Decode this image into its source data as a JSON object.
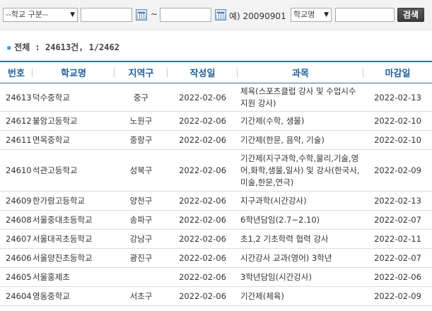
{
  "search": {
    "category_select": "--학교 구분--",
    "example_label": "예) 20090901",
    "field_select": "학교명",
    "tilde": "~",
    "button": "검색",
    "date_from": "",
    "date_to": "",
    "keyword": ""
  },
  "summary": {
    "text": "전체 : 24613건, 1/2462"
  },
  "table": {
    "headers": [
      "번호",
      "학교명",
      "지역구",
      "작성일",
      "과목",
      "마감일"
    ],
    "rows": [
      {
        "no": "24613",
        "school": "덕수중학교",
        "district": "중구",
        "written": "2022-02-06",
        "subject": "체육(스포츠클럽 강사 및 수업시수 지원 강사)",
        "deadline": "2022-02-13"
      },
      {
        "no": "24612",
        "school": "불암고등학교",
        "district": "노원구",
        "written": "2022-02-06",
        "subject": "기간제(수학, 생물)",
        "deadline": "2022-02-10"
      },
      {
        "no": "24611",
        "school": "면목중학교",
        "district": "중랑구",
        "written": "2022-02-06",
        "subject": "기간제(한문, 음악, 기술)",
        "deadline": "2022-02-10"
      },
      {
        "no": "24610",
        "school": "석관고등학교",
        "district": "성북구",
        "written": "2022-02-06",
        "subject": "기간제(지구과학,수학,물리,기술,영어,화학,생물,일사) 및 강사(한국사,미술,한문,연극)",
        "deadline": "2022-02-09"
      },
      {
        "no": "24609",
        "school": "한가람고등학교",
        "district": "양천구",
        "written": "2022-02-06",
        "subject": "지구과학(시간강사)",
        "deadline": "2022-02-13"
      },
      {
        "no": "24608",
        "school": "서울중대초등학교",
        "district": "송파구",
        "written": "2022-02-06",
        "subject": "6학년담임(2.7~2.10)",
        "deadline": "2022-02-07"
      },
      {
        "no": "24607",
        "school": "서울대곡초등학교",
        "district": "강남구",
        "written": "2022-02-06",
        "subject": "초1,2 기초학력 협력 강사",
        "deadline": "2022-02-11"
      },
      {
        "no": "24606",
        "school": "서울양진초등학교",
        "district": "광진구",
        "written": "2022-02-06",
        "subject": "시간강사 교과(영어) 3학년",
        "deadline": "2022-02-07"
      },
      {
        "no": "24605",
        "school": "서울홍제초",
        "district": "",
        "written": "2022-02-06",
        "subject": "3학년담임(시간강사)",
        "deadline": "2022-02-06"
      },
      {
        "no": "24604",
        "school": "영동중학교",
        "district": "서초구",
        "written": "2022-02-06",
        "subject": "기간제(체육)",
        "deadline": "2022-02-09"
      }
    ]
  }
}
